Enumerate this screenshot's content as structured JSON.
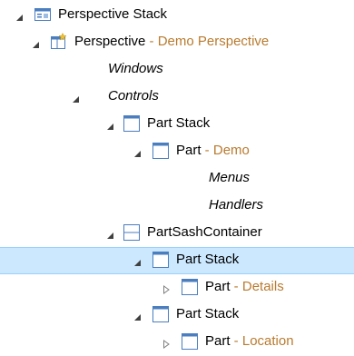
{
  "tree": {
    "nodes": [
      {
        "label": "Perspective Stack",
        "separator": "",
        "detail": "",
        "icon": "perspective-stack-icon",
        "expander": "expanded",
        "italic": false,
        "selected": false
      },
      {
        "label": "Perspective",
        "separator": " - ",
        "detail": "Demo Perspective",
        "icon": "perspective-icon",
        "expander": "expanded",
        "italic": false,
        "selected": false
      },
      {
        "label": "Windows",
        "separator": "",
        "detail": "",
        "icon": "",
        "expander": "none",
        "italic": true,
        "selected": false
      },
      {
        "label": "Controls",
        "separator": "",
        "detail": "",
        "icon": "",
        "expander": "expanded",
        "italic": true,
        "selected": false
      },
      {
        "label": "Part Stack",
        "separator": "",
        "detail": "",
        "icon": "part-stack-icon",
        "expander": "expanded",
        "italic": false,
        "selected": false
      },
      {
        "label": "Part",
        "separator": " - ",
        "detail": "Demo",
        "icon": "part-icon",
        "expander": "expanded",
        "italic": false,
        "selected": false
      },
      {
        "label": "Menus",
        "separator": "",
        "detail": "",
        "icon": "",
        "expander": "none",
        "italic": true,
        "selected": false
      },
      {
        "label": "Handlers",
        "separator": "",
        "detail": "",
        "icon": "",
        "expander": "none",
        "italic": true,
        "selected": false
      },
      {
        "label": "PartSashContainer",
        "separator": "",
        "detail": "",
        "icon": "part-sash-container-icon",
        "expander": "expanded",
        "italic": false,
        "selected": false
      },
      {
        "label": "Part Stack",
        "separator": "",
        "detail": "",
        "icon": "part-stack-icon",
        "expander": "expanded",
        "italic": false,
        "selected": true
      },
      {
        "label": "Part",
        "separator": " - ",
        "detail": "Details",
        "icon": "part-icon",
        "expander": "collapsed",
        "italic": false,
        "selected": false
      },
      {
        "label": "Part Stack",
        "separator": "",
        "detail": "",
        "icon": "part-stack-icon",
        "expander": "expanded",
        "italic": false,
        "selected": false
      },
      {
        "label": "Part",
        "separator": " - ",
        "detail": "Location",
        "icon": "part-icon",
        "expander": "collapsed",
        "italic": false,
        "selected": false
      }
    ]
  },
  "colors": {
    "detail_text": "#b97b2f",
    "selection_background": "#cce8ff",
    "selection_border": "#99d1ff",
    "icon_blue": "#4a7ebf"
  }
}
